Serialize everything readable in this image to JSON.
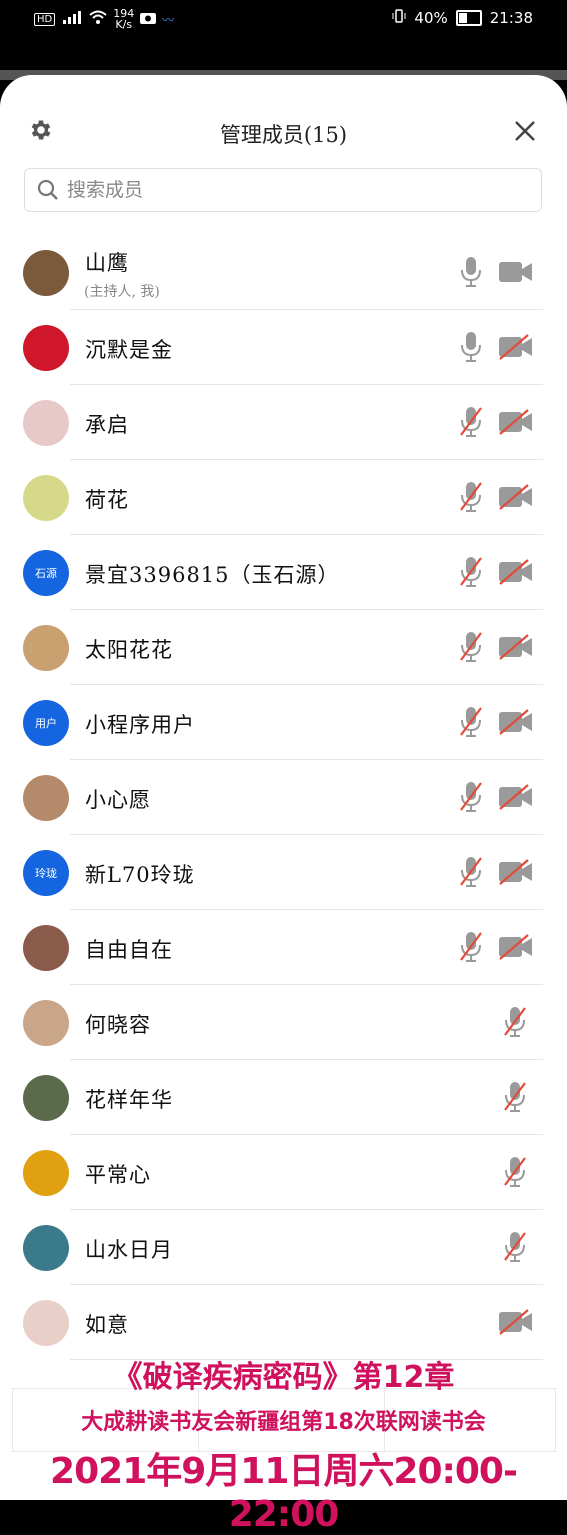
{
  "status_bar": {
    "hd": "HD",
    "net_speed": "194",
    "net_unit": "K/s",
    "battery": "40%",
    "time": "21:38"
  },
  "header": {
    "title": "管理成员(15)"
  },
  "search": {
    "placeholder": "搜索成员"
  },
  "members": [
    {
      "name": "山鹰",
      "sub": "(主持人, 我)",
      "mic": "on",
      "cam": "on",
      "avatar_color": "#7a5a3a"
    },
    {
      "name": "沉默是金",
      "mic": "on",
      "cam": "off",
      "avatar_color": "#d0162a"
    },
    {
      "name": "承启",
      "mic": "off",
      "cam": "off",
      "avatar_color": "#e8c9c9"
    },
    {
      "name": "荷花",
      "mic": "off",
      "cam": "off",
      "avatar_color": "#d7d98a"
    },
    {
      "name": "景宜3396815（玉石源）",
      "mic": "off",
      "cam": "off",
      "avatar_color": "#1565e0",
      "avatar_text": "石源"
    },
    {
      "name": "太阳花花",
      "mic": "off",
      "cam": "off",
      "avatar_color": "#c9a070"
    },
    {
      "name": "小程序用户",
      "mic": "off",
      "cam": "off",
      "avatar_color": "#1565e0",
      "avatar_text": "用户"
    },
    {
      "name": "小心愿",
      "mic": "off",
      "cam": "off",
      "avatar_color": "#b48a6a"
    },
    {
      "name": "新L70玲珑",
      "mic": "off",
      "cam": "off",
      "avatar_color": "#1565e0",
      "avatar_text": "玲珑"
    },
    {
      "name": "自由自在",
      "mic": "off",
      "cam": "off",
      "avatar_color": "#8a5a4a"
    },
    {
      "name": "何晓容",
      "mic": "off",
      "cam": "none",
      "avatar_color": "#c9a58a"
    },
    {
      "name": "花样年华",
      "mic": "off",
      "cam": "none",
      "avatar_color": "#5a6a4a"
    },
    {
      "name": "平常心",
      "mic": "off",
      "cam": "none",
      "avatar_color": "#e0a010"
    },
    {
      "name": "山水日月",
      "mic": "off",
      "cam": "none",
      "avatar_color": "#3a7a8a"
    },
    {
      "name": "如意",
      "mic": "none",
      "cam": "off",
      "avatar_color": "#e8d0c8"
    }
  ],
  "overlay": {
    "line1": "《破译疾病密码》第12章",
    "line2": "大成耕读书友会新疆组第18次联网读书会",
    "line3": "2021年9月11日周六20:00-22:00"
  },
  "colors": {
    "accent_blue": "#1565e0",
    "icon_gray": "#9a9a9a",
    "muted_red": "#e24a3a",
    "overlay_text": "#d0125e"
  }
}
